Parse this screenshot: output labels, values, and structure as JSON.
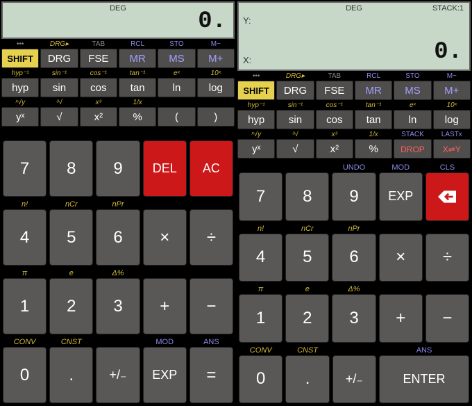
{
  "left": {
    "display": {
      "mode": "DEG",
      "value": "0."
    },
    "fr1": {
      "sup": [
        "•••",
        "DRG▸",
        "TAB",
        "RCL",
        "STO",
        "M−"
      ],
      "label": [
        "SHIFT",
        "DRG",
        "FSE",
        "MR",
        "MS",
        "M+"
      ]
    },
    "fr2": {
      "sup": [
        "hyp⁻¹",
        "sin⁻¹",
        "cos⁻¹",
        "tan⁻¹",
        "eˣ",
        "10ˣ"
      ],
      "label": [
        "hyp",
        "sin",
        "cos",
        "tan",
        "ln",
        "log"
      ]
    },
    "fr3": {
      "sup": [
        "ˣ√y",
        "³√",
        "x³",
        "1/x",
        "",
        ""
      ],
      "label": [
        "yˣ",
        "√",
        "x²",
        "%",
        "(",
        ")"
      ]
    },
    "nr1": {
      "sup": [
        "",
        "",
        "",
        "",
        ""
      ],
      "label": [
        "7",
        "8",
        "9",
        "DEL",
        "AC"
      ]
    },
    "nr2": {
      "sup": [
        "n!",
        "nCr",
        "nPr",
        "",
        ""
      ],
      "label": [
        "4",
        "5",
        "6",
        "×",
        "÷"
      ]
    },
    "nr3": {
      "sup": [
        "π",
        "e",
        "Δ%",
        "",
        ""
      ],
      "label": [
        "1",
        "2",
        "3",
        "+",
        "−"
      ]
    },
    "nr4": {
      "sup": [
        "CONV",
        "CNST",
        "",
        "MOD",
        "ANS"
      ],
      "label": [
        "0",
        ".",
        "+/₋",
        "EXP",
        "="
      ]
    }
  },
  "right": {
    "display": {
      "mode": "DEG",
      "stack": "STACK:1",
      "y": "Y:",
      "x_label": "X:",
      "x_value": "0."
    },
    "fr1": {
      "sup": [
        "•••",
        "DRG▸",
        "TAB",
        "RCL",
        "STO",
        "M−"
      ],
      "label": [
        "SHIFT",
        "DRG",
        "FSE",
        "MR",
        "MS",
        "M+"
      ]
    },
    "fr2": {
      "sup": [
        "hyp⁻¹",
        "sin⁻¹",
        "cos⁻¹",
        "tan⁻¹",
        "eˣ",
        "10ˣ"
      ],
      "label": [
        "hyp",
        "sin",
        "cos",
        "tan",
        "ln",
        "log"
      ]
    },
    "fr3": {
      "sup": [
        "ˣ√y",
        "³√",
        "x³",
        "1/x",
        "STACK",
        "LASTx"
      ],
      "label": [
        "yˣ",
        "√",
        "x²",
        "%",
        "DROP",
        "X⇌Y"
      ]
    },
    "nr1": {
      "sup": [
        "",
        "",
        "UNDO",
        "MOD",
        "CLS"
      ],
      "label": [
        "7",
        "8",
        "9",
        "EXP",
        "⬅"
      ]
    },
    "nr2": {
      "sup": [
        "n!",
        "nCr",
        "nPr",
        "",
        ""
      ],
      "label": [
        "4",
        "5",
        "6",
        "×",
        "÷"
      ]
    },
    "nr3": {
      "sup": [
        "π",
        "e",
        "Δ%",
        "",
        ""
      ],
      "label": [
        "1",
        "2",
        "3",
        "+",
        "−"
      ]
    },
    "nr4": {
      "sup": [
        "CONV",
        "CNST",
        "",
        "ANS"
      ],
      "label": [
        "0",
        ".",
        "+/₋",
        "ENTER"
      ]
    }
  }
}
